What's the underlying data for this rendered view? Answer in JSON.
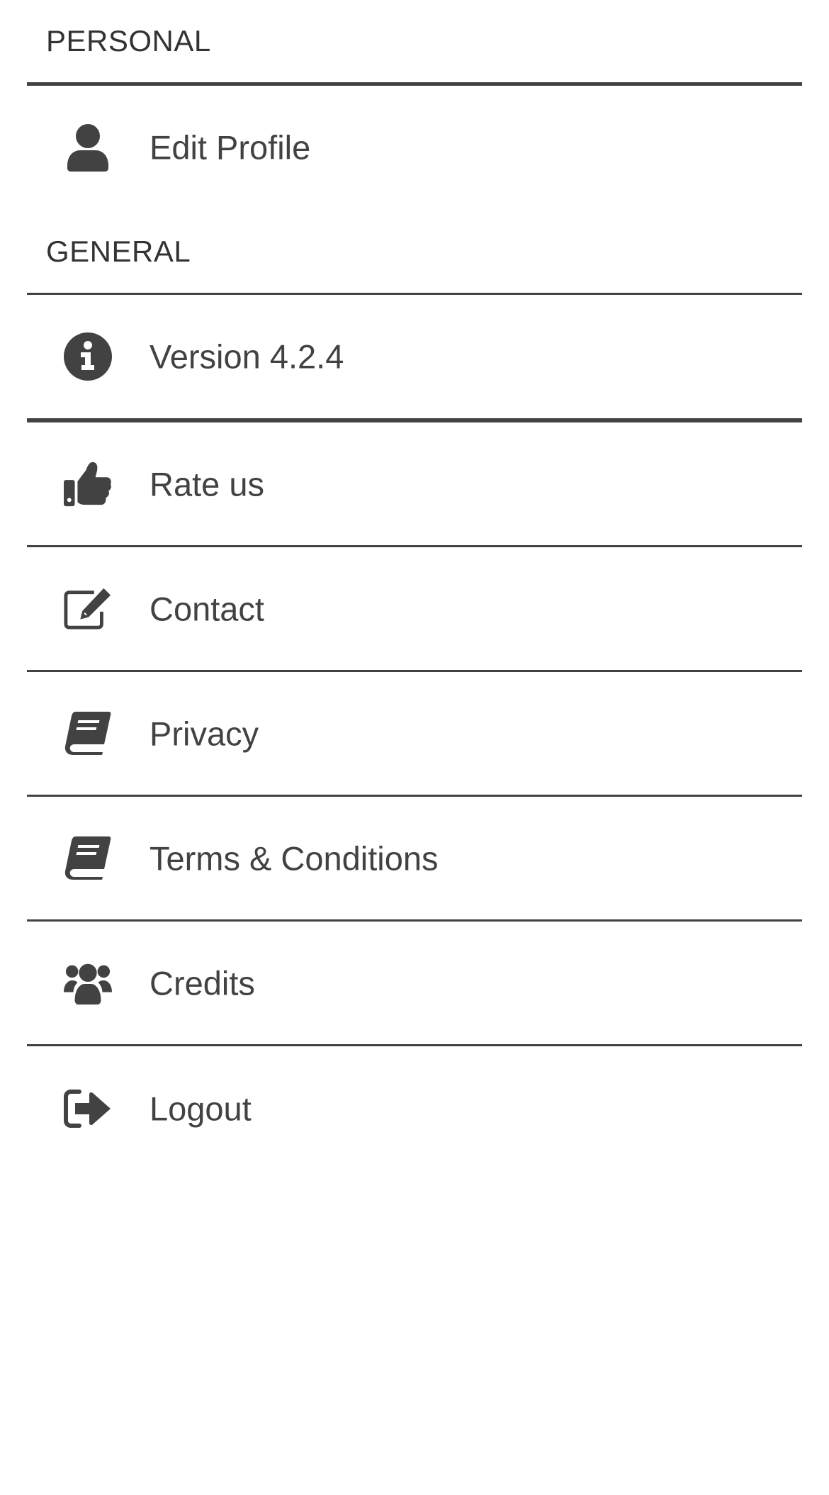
{
  "colors": {
    "text": "#424242",
    "divider": "#424242",
    "background": "#ffffff"
  },
  "sections": {
    "personal": {
      "title": "PERSONAL",
      "items": [
        {
          "label": "Edit Profile",
          "icon": "user-icon"
        }
      ]
    },
    "general": {
      "title": "GENERAL",
      "items": [
        {
          "label": "Version 4.2.4",
          "icon": "info-circle-icon"
        },
        {
          "label": "Rate us",
          "icon": "thumbs-up-icon"
        },
        {
          "label": "Contact",
          "icon": "edit-icon"
        },
        {
          "label": "Privacy",
          "icon": "book-icon"
        },
        {
          "label": "Terms & Conditions",
          "icon": "book-icon"
        },
        {
          "label": "Credits",
          "icon": "users-icon"
        },
        {
          "label": "Logout",
          "icon": "sign-out-icon"
        }
      ]
    }
  }
}
